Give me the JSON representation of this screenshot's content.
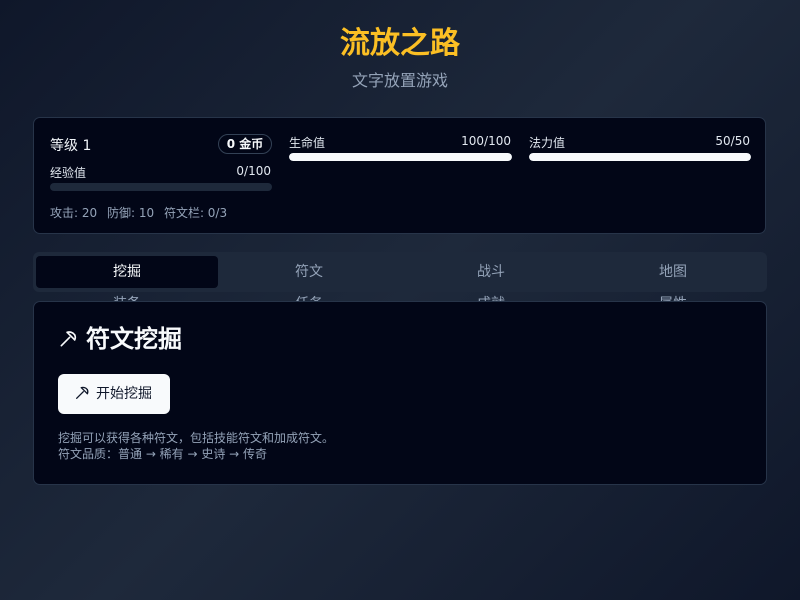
{
  "header": {
    "title": "流放之路",
    "subtitle": "文字放置游戏"
  },
  "stats": {
    "level_label": "等级 1",
    "gold_badge": "0 金币",
    "exp": {
      "label": "经验值",
      "value_text": "0/100",
      "fraction": 0.0
    },
    "hp": {
      "label": "生命值",
      "value_text": "100/100",
      "fraction": 1.0
    },
    "mp": {
      "label": "法力值",
      "value_text": "50/50",
      "fraction": 1.0
    },
    "attack": "攻击: 20",
    "defense": "防御: 10",
    "rune_slots": "符文栏: 0/3"
  },
  "tabs": [
    {
      "label": "挖掘",
      "active": true
    },
    {
      "label": "符文",
      "active": false
    },
    {
      "label": "战斗",
      "active": false
    },
    {
      "label": "地图",
      "active": false
    },
    {
      "label": "装备",
      "active": false
    },
    {
      "label": "任务",
      "active": false
    },
    {
      "label": "成就",
      "active": false
    },
    {
      "label": "属性",
      "active": false
    }
  ],
  "panel": {
    "title": "符文挖掘",
    "title_icon": "pickaxe-icon",
    "start_button": "开始挖掘",
    "start_button_icon": "pickaxe-icon",
    "desc_line1": "挖掘可以获得各种符文，包括技能符文和加成符文。",
    "desc_line2": "符文品质：普通 → 稀有 → 史诗 → 传奇"
  },
  "colors": {
    "accent": "#fbbf24",
    "card_bg": "#020617",
    "bar_fill": "#f8fafc",
    "bar_track": "#1e293b"
  }
}
